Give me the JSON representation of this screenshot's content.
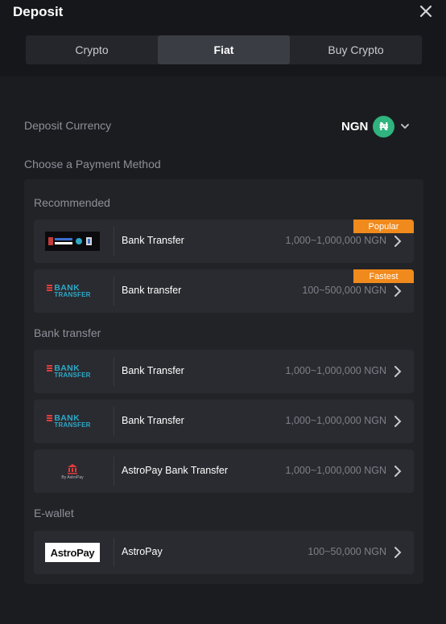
{
  "header": {
    "title": "Deposit"
  },
  "tabs": [
    {
      "label": "Crypto",
      "active": false
    },
    {
      "label": "Fiat",
      "active": true
    },
    {
      "label": "Buy Crypto",
      "active": false
    }
  ],
  "deposit_currency": {
    "label": "Deposit Currency",
    "code": "NGN",
    "symbol": "₦",
    "symbol_color": "#2fb37f"
  },
  "payment": {
    "label": "Choose a Payment Method",
    "sections": {
      "recommended": "Recommended",
      "bank_transfer": "Bank transfer",
      "ewallet": "E-wallet"
    },
    "recommended": [
      {
        "name": "Bank Transfer",
        "range": "1,000~1,000,000 NGN",
        "badge": "Popular",
        "logo": "multi-bank-logo"
      },
      {
        "name": "Bank transfer",
        "range": "100~500,000 NGN",
        "badge": "Fastest",
        "logo": "bank-transfer-logo"
      }
    ],
    "bank_transfer": [
      {
        "name": "Bank Transfer",
        "range": "1,000~1,000,000 NGN",
        "logo": "bank-transfer-logo"
      },
      {
        "name": "Bank Transfer",
        "range": "1,000~1,000,000 NGN",
        "logo": "bank-transfer-logo"
      },
      {
        "name": "AstroPay Bank Transfer",
        "range": "1,000~1,000,000 NGN",
        "logo": "astropay-bank-logo"
      }
    ],
    "ewallet": [
      {
        "name": "AstroPay",
        "range": "100~50,000 NGN",
        "logo": "astropay-logo"
      }
    ]
  },
  "logos": {
    "bank_transfer_line1": "BANK",
    "bank_transfer_line2": "TRANSFER",
    "astropay": "AstroPay",
    "astropay_by": "By AstroPay"
  },
  "colors": {
    "badge": "#f08a1c",
    "accent_blue": "#2ea8c8",
    "accent_red": "#e23b3b"
  }
}
